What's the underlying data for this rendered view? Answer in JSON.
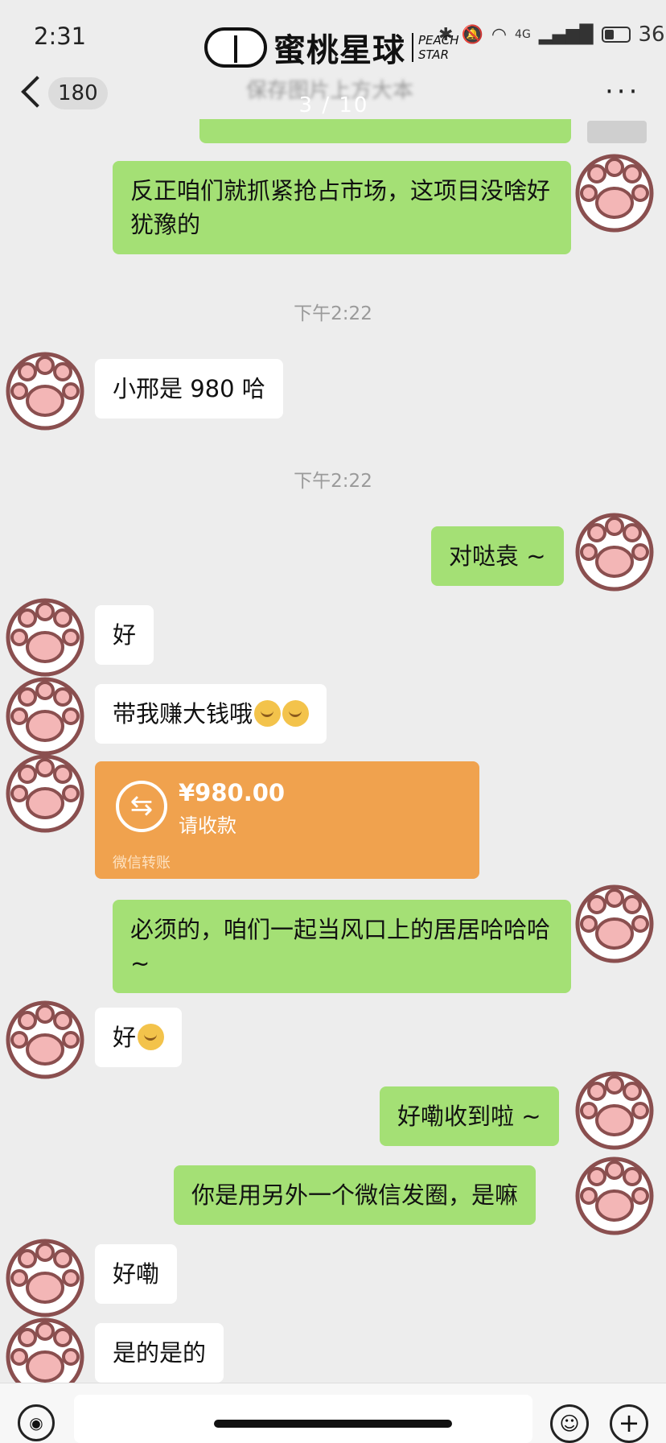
{
  "status_bar": {
    "time": "2:31",
    "battery": "36%",
    "network": "4G"
  },
  "watermark": {
    "text": "蜜桃星球",
    "sub_line1": "PEACH",
    "sub_line2": "STAR"
  },
  "nav": {
    "unread_count": "180",
    "title": "保存图片上方大本",
    "page_indicator": "3 / 10"
  },
  "messages": [
    {
      "sender": "me",
      "text": "反正咱们就抓紧抢占市场，这项目没啥好犹豫的"
    },
    {
      "type": "time",
      "text": "下午2:22"
    },
    {
      "sender": "them",
      "text": "小邢是 980 哈"
    },
    {
      "type": "time",
      "text": "下午2:22"
    },
    {
      "sender": "me",
      "text": "对哒袁 ~"
    },
    {
      "sender": "them",
      "text": "好"
    },
    {
      "sender": "them",
      "text": "带我赚大钱哦"
    },
    {
      "sender": "them",
      "type": "transfer",
      "amount": "¥980.00",
      "status": "请收款",
      "footer": "微信转账"
    },
    {
      "sender": "me",
      "text": "必须的，咱们一起当风口上的居居哈哈哈 ~"
    },
    {
      "sender": "them",
      "text": "好"
    },
    {
      "sender": "me",
      "text": "好嘞收到啦 ~"
    },
    {
      "sender": "me",
      "text": "你是用另外一个微信发圈，是嘛"
    },
    {
      "sender": "them",
      "text": "好嘞"
    },
    {
      "sender": "them",
      "text": "是的是的"
    }
  ],
  "colors": {
    "background": "#ededed",
    "my_bubble": "#a4e075",
    "their_bubble": "#ffffff",
    "transfer_card": "#f0a24e"
  },
  "icons": {
    "back": "chevron-left-icon",
    "more": "more-dots-icon",
    "avatar": "paw-avatar-icon",
    "voice": "voice-icon",
    "emoji": "emoji-icon",
    "plus": "plus-icon",
    "transfer": "transfer-arrows-icon"
  }
}
